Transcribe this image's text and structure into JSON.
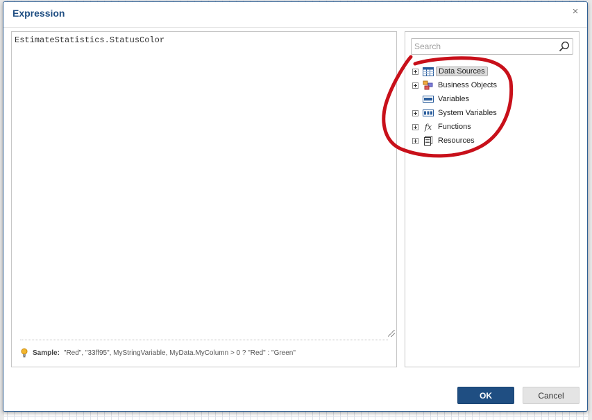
{
  "dialog": {
    "title": "Expression",
    "close_symbol": "×"
  },
  "editor": {
    "value": "EstimateStatistics.StatusColor"
  },
  "sample": {
    "label": "Sample:",
    "text": "\"Red\",  \"33ff95\",  MyStringVariable,  MyData.MyColumn > 0 ? \"Red\" : \"Green\""
  },
  "search": {
    "placeholder": "Search",
    "value": ""
  },
  "tree": {
    "items": [
      {
        "label": "Data Sources",
        "icon": "datasource-icon",
        "expandable": true,
        "selected": true
      },
      {
        "label": "Business Objects",
        "icon": "business-objects-icon",
        "expandable": true,
        "selected": false
      },
      {
        "label": "Variables",
        "icon": "variable-icon",
        "expandable": false,
        "selected": false
      },
      {
        "label": "System Variables",
        "icon": "system-variables-icon",
        "expandable": true,
        "selected": false
      },
      {
        "label": "Functions",
        "icon": "function-icon",
        "expandable": true,
        "selected": false
      },
      {
        "label": "Resources",
        "icon": "resources-icon",
        "expandable": true,
        "selected": false
      }
    ],
    "fx_glyph": "fx"
  },
  "buttons": {
    "ok": "OK",
    "cancel": "Cancel"
  },
  "colors": {
    "accent": "#1f4e82",
    "annotation": "#c8101a"
  }
}
